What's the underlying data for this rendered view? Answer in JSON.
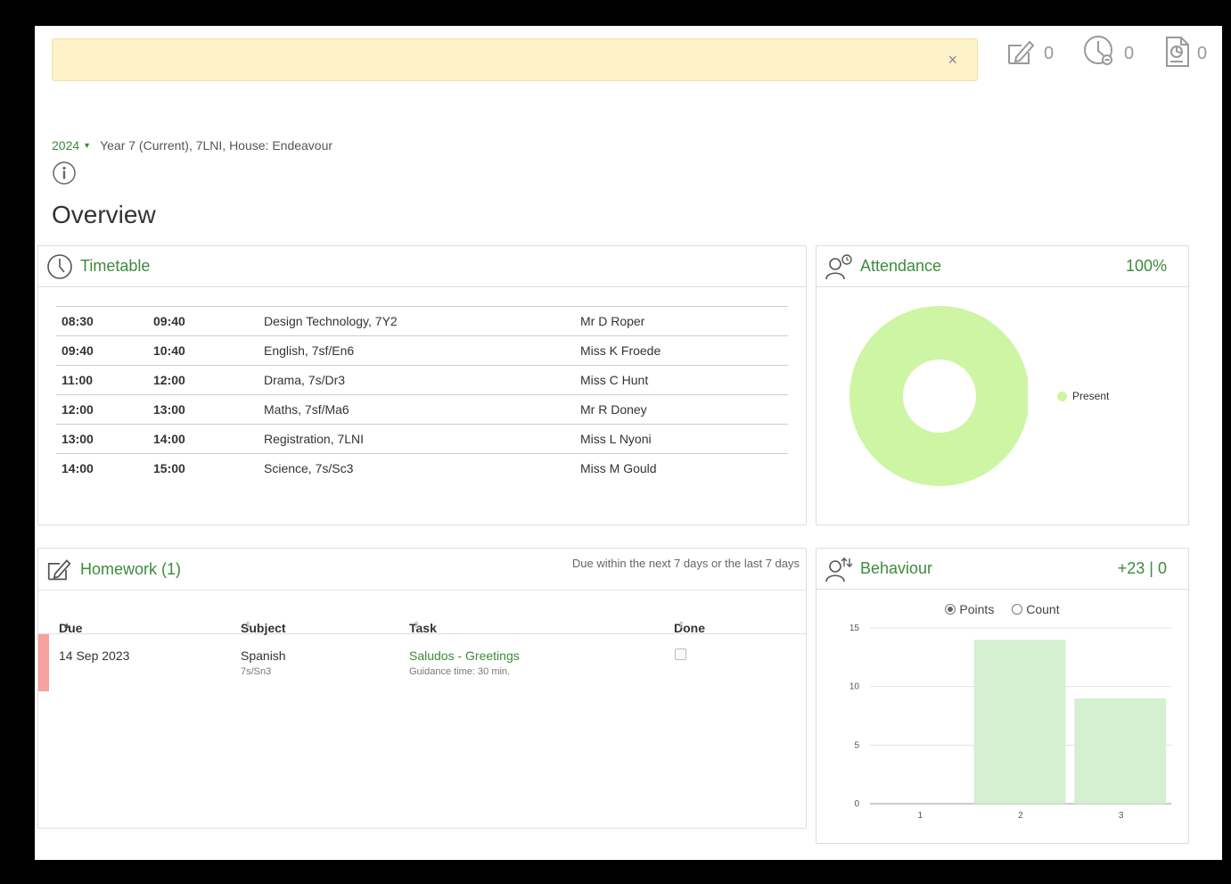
{
  "notice": {
    "close_label": "×"
  },
  "counters": [
    {
      "icon": "homework-icon",
      "value": "0"
    },
    {
      "icon": "clock-icon",
      "value": "0"
    },
    {
      "icon": "report-icon",
      "value": "0"
    }
  ],
  "context": {
    "year": "2024",
    "details": "Year 7 (Current), 7LNI, House: Endeavour"
  },
  "page_title": "Overview",
  "timetable": {
    "title": "Timetable",
    "rows": [
      {
        "start": "08:30",
        "end": "09:40",
        "lesson": "Design Technology, 7Y2",
        "teacher": "Mr D Roper"
      },
      {
        "start": "09:40",
        "end": "10:40",
        "lesson": "English, 7sf/En6",
        "teacher": "Miss K Froede"
      },
      {
        "start": "11:00",
        "end": "12:00",
        "lesson": "Drama, 7s/Dr3",
        "teacher": "Miss C Hunt"
      },
      {
        "start": "12:00",
        "end": "13:00",
        "lesson": "Maths, 7sf/Ma6",
        "teacher": "Mr R Doney"
      },
      {
        "start": "13:00",
        "end": "14:00",
        "lesson": "Registration, 7LNI",
        "teacher": "Miss L Nyoni"
      },
      {
        "start": "14:00",
        "end": "15:00",
        "lesson": "Science, 7s/Sc3",
        "teacher": "Miss M Gould"
      }
    ]
  },
  "attendance": {
    "title": "Attendance",
    "percent": "100%",
    "legend": "Present",
    "color": "#cef5a3"
  },
  "homework": {
    "title": "Homework (1)",
    "note": "Due within the next 7 days or the last 7 days",
    "columns": {
      "due": "Due",
      "subject": "Subject",
      "task": "Task",
      "done": "Done"
    },
    "rows": [
      {
        "due": "14 Sep 2023",
        "subject": "Spanish",
        "class": "7s/Sn3",
        "task": "Saludos - Greetings",
        "guidance": "Guidance time: 30 min.",
        "done": false,
        "flag_color": "#f7a29c"
      }
    ]
  },
  "behaviour": {
    "title": "Behaviour",
    "score": "+23 | 0",
    "toggle": {
      "points": "Points",
      "count": "Count",
      "selected": "points"
    }
  },
  "chart_data": {
    "type": "bar",
    "categories": [
      "1",
      "2",
      "3"
    ],
    "values": [
      0,
      14,
      9
    ],
    "ylim": [
      0,
      15
    ],
    "yticks": [
      "0",
      "5",
      "10",
      "15"
    ],
    "grid": true,
    "color": "#d3f0cf"
  }
}
